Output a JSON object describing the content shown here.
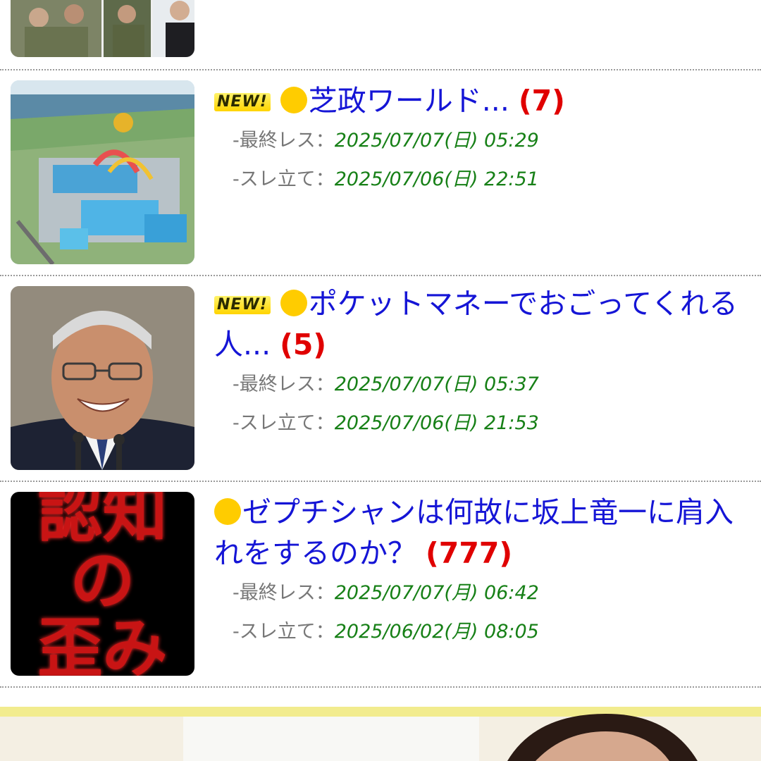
{
  "threads": [
    {
      "image": "military-photo-thumbnail"
    },
    {
      "image": "waterpark-aerial-thumbnail",
      "new_label": "NEW!",
      "title": "芝政ワールド...",
      "count": "(7)",
      "last_res_label": "-最終レス：",
      "last_res": "2025/07/07(日) 05:29",
      "created_label": "-スレ立て：",
      "created": "2025/07/06(日) 22:51"
    },
    {
      "image": "smiling-politician-thumbnail",
      "new_label": "NEW!",
      "title": "ポケットマネーでおごってくれる人...",
      "count": "(5)",
      "last_res_label": "-最終レス：",
      "last_res": "2025/07/07(日) 05:37",
      "created_label": "-スレ立て：",
      "created": "2025/07/06(日) 21:53"
    },
    {
      "image": "red-text-poster-thumbnail",
      "thumb_text": [
        "認知",
        "の",
        "歪み"
      ],
      "title": "ゼプチシャンは何故に坂上竜一に肩入れをするのか？",
      "count": "(777)",
      "last_res_label": "-最終レス：",
      "last_res": "2025/07/07(月) 06:42",
      "created_label": "-スレ立て：",
      "created": "2025/06/02(月) 08:05"
    }
  ],
  "banner": {
    "image": "ad-banner-photo"
  },
  "colors": {
    "title": "#1515d6",
    "count": "#e00000",
    "date": "#178017",
    "meta_label": "#777777",
    "dot": "#ffcc00"
  }
}
